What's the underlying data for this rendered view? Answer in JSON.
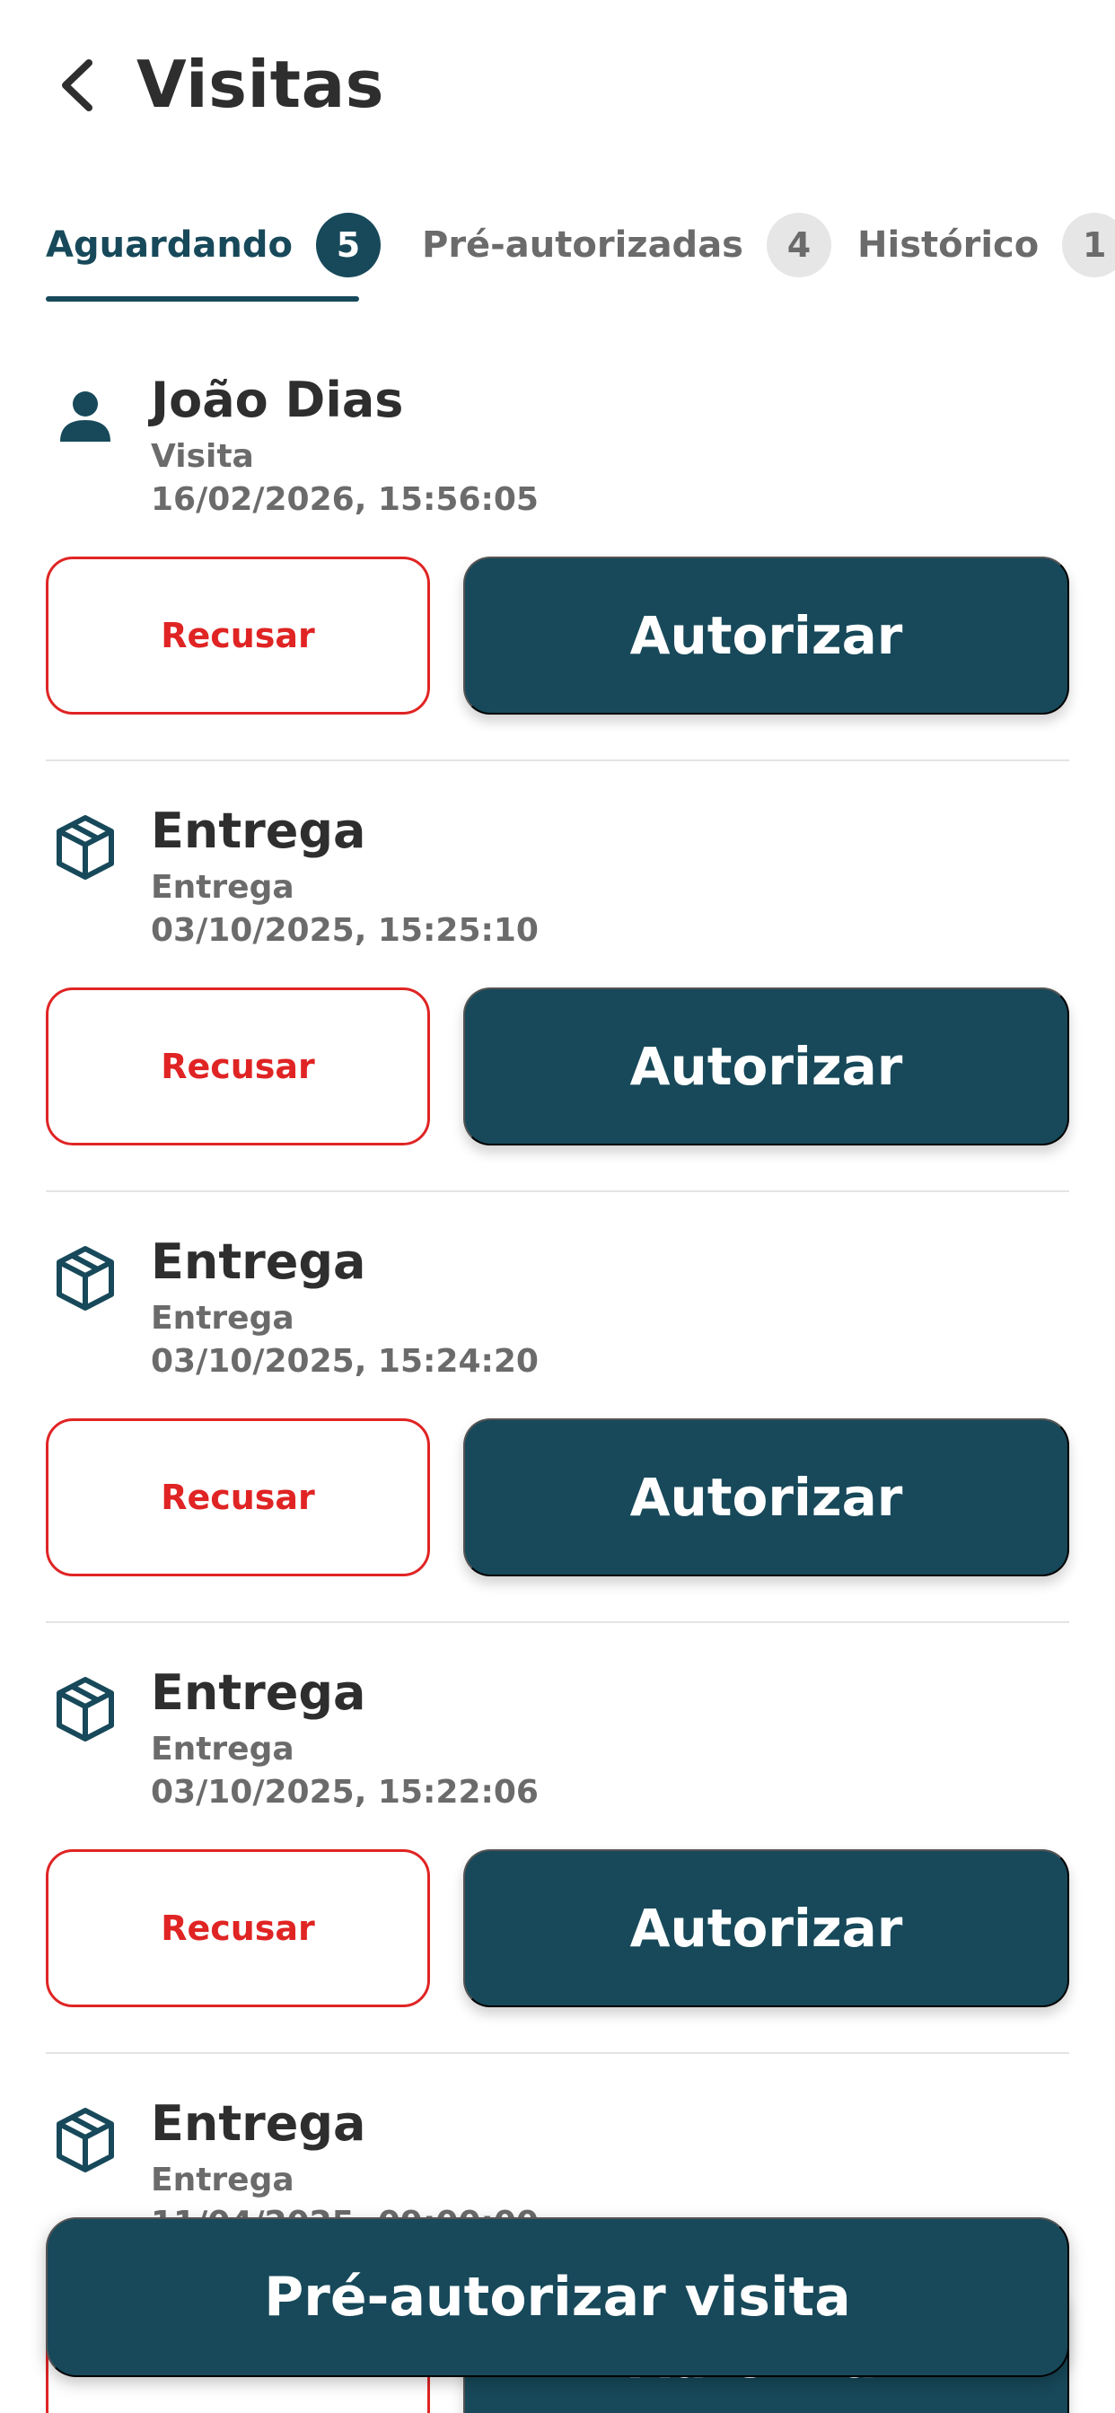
{
  "header": {
    "title": "Visitas",
    "back_icon": "chevron-left-icon"
  },
  "tabs": [
    {
      "label": "Aguardando",
      "count": "5",
      "active": true
    },
    {
      "label": "Pré-autorizadas",
      "count": "4",
      "active": false
    },
    {
      "label": "Histórico",
      "count": "1",
      "active": false
    }
  ],
  "visits": [
    {
      "icon": "person-icon",
      "name": "João Dias",
      "kind": "Visita",
      "time": "16/02/2026, 15:56:05",
      "refuse_label": "Recusar",
      "authorize_label": "Autorizar"
    },
    {
      "icon": "package-icon",
      "name": "Entrega",
      "kind": "Entrega",
      "time": "03/10/2025, 15:25:10",
      "refuse_label": "Recusar",
      "authorize_label": "Autorizar"
    },
    {
      "icon": "package-icon",
      "name": "Entrega",
      "kind": "Entrega",
      "time": "03/10/2025, 15:24:20",
      "refuse_label": "Recusar",
      "authorize_label": "Autorizar"
    },
    {
      "icon": "package-icon",
      "name": "Entrega",
      "kind": "Entrega",
      "time": "03/10/2025, 15:22:06",
      "refuse_label": "Recusar",
      "authorize_label": "Autorizar"
    },
    {
      "icon": "package-icon",
      "name": "Entrega",
      "kind": "Entrega",
      "time": "11/04/2025, 09:00:00",
      "refuse_label": "Recusar",
      "authorize_label": "Autorizar"
    }
  ],
  "fab": {
    "label": "Pré-autorizar visita"
  },
  "colors": {
    "primary": "#17495a",
    "danger": "#e02424",
    "text": "#2e2e2e",
    "muted": "#6b6b6b"
  }
}
